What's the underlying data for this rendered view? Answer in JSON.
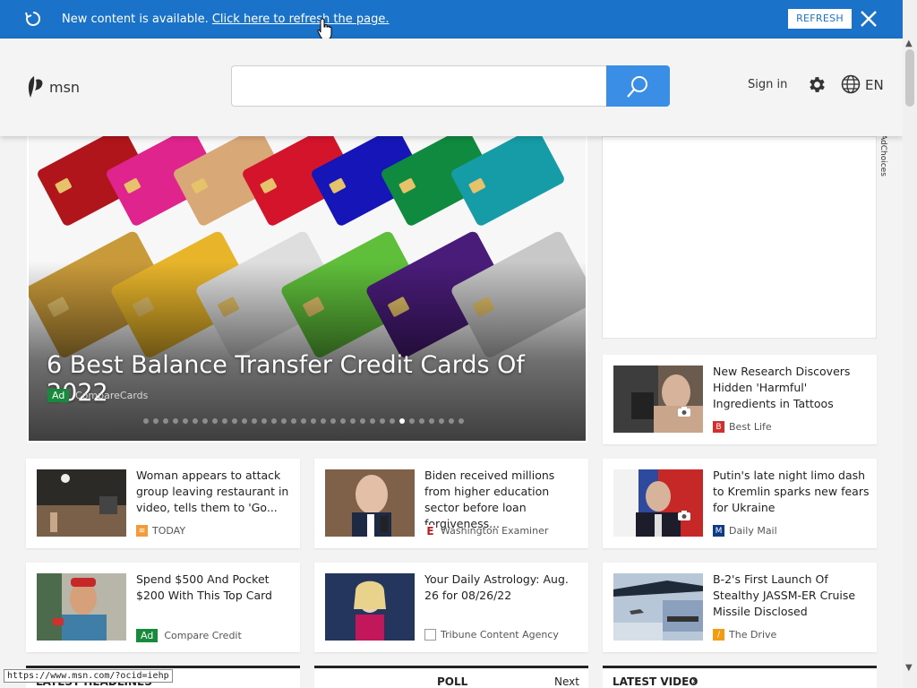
{
  "notification": {
    "message": "New content is available.",
    "link": "Click here to refresh the page.",
    "refresh_label": "REFRESH"
  },
  "header": {
    "logo_text": "msn",
    "search_placeholder": "",
    "sign_in": "Sign in",
    "language": "EN"
  },
  "hero": {
    "title": "6 Best Balance Transfer Credit Cards Of 2022",
    "ad_label": "Ad",
    "source": "CompareCards",
    "dot_count": 33,
    "active_dot": 26
  },
  "ad_choices": "AdChoices",
  "cards": [
    {
      "title": "New Research Discovers Hidden 'Harmful' Ingredients in Tattoos",
      "source": "Best Life",
      "source_color": "#d32f2f"
    },
    {
      "title": "Woman appears to attack group leaving restaurant in video, tells them to 'Go...",
      "source": "TODAY",
      "source_color": "#f29b38"
    },
    {
      "title": "Biden received millions from higher education sector before loan forgiveness...",
      "source": "Washington Examiner",
      "source_color": "#b71c1c"
    },
    {
      "title": "Putin's late night limo dash to Kremlin sparks new fears for Ukraine",
      "source": "Daily Mail",
      "source_color": "#0d3b87"
    },
    {
      "title": "Spend $500 And Pocket $200 With This Top Card",
      "source": "Compare Credit",
      "ad_label": "Ad"
    },
    {
      "title": "Your Daily Astrology: Aug. 26 for 08/26/22",
      "source": "Tribune Content Agency",
      "source_color": "#888888"
    },
    {
      "title": "B-2's First Launch Of Stealthy JASSM-ER Cruise Missile Disclosed",
      "source": "The Drive",
      "source_color": "#f39c12"
    }
  ],
  "sections": {
    "latest_headlines": "LATEST HEADLINES",
    "poll": "POLL",
    "next": "Next",
    "latest_video": "LATEST VIDEO"
  },
  "status_url": "https://www.msn.com/?ocid=iehp",
  "colors": {
    "notify_bar": "#1a73c8",
    "search_button": "#3a8ee6",
    "ad_badge": "#188a3c"
  }
}
